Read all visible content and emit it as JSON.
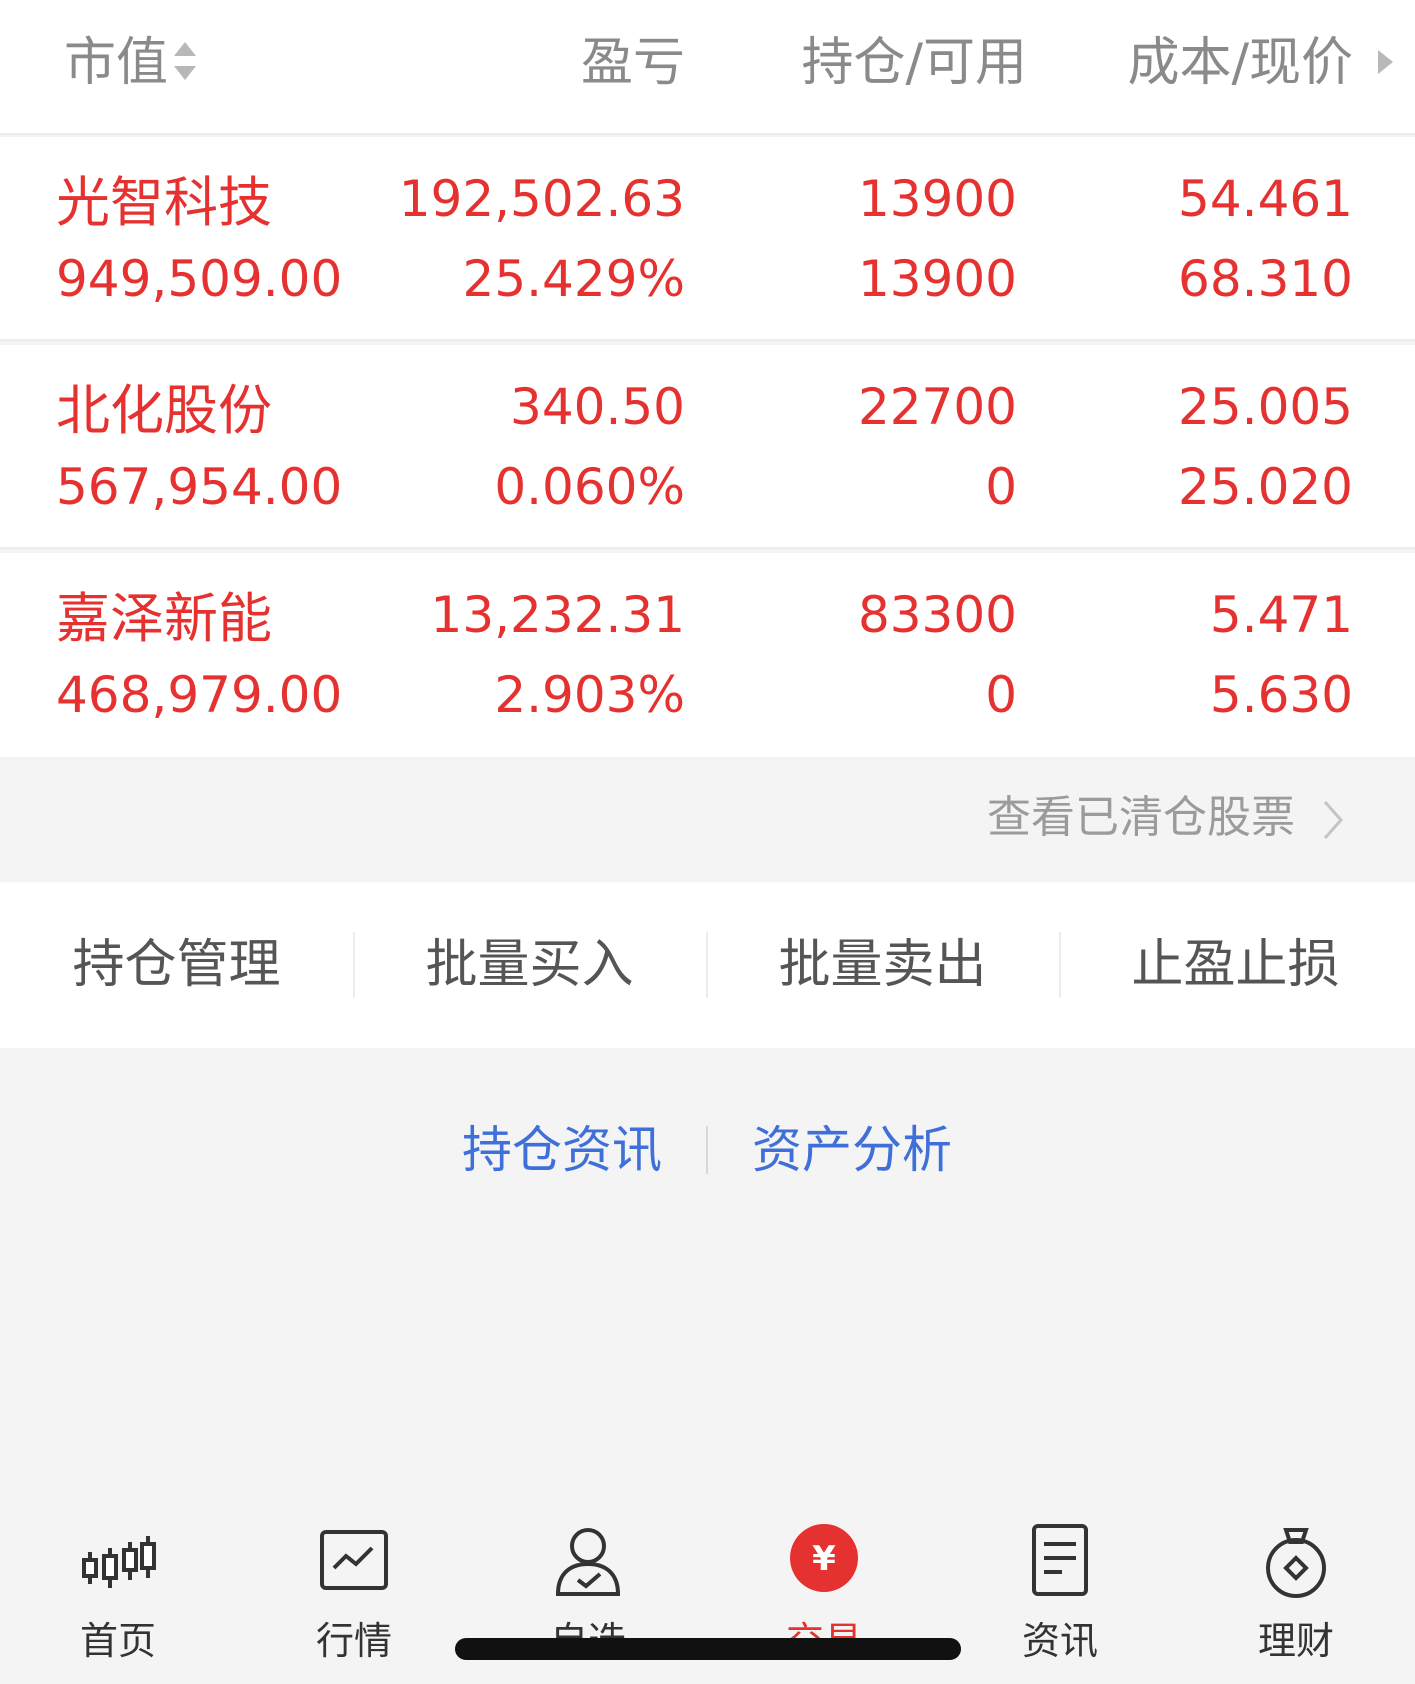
{
  "header": {
    "market_value": "市值",
    "profit_loss": "盈亏",
    "position_available": "持仓/可用",
    "cost_price": "成本/现价"
  },
  "holdings": [
    {
      "name": "光智科技",
      "market_value": "949,509.00",
      "profit_loss": "192,502.63",
      "profit_loss_pct": "25.429%",
      "position": "13900",
      "available": "13900",
      "cost": "54.461",
      "price": "68.310"
    },
    {
      "name": "北化股份",
      "market_value": "567,954.00",
      "profit_loss": "340.50",
      "profit_loss_pct": "0.060%",
      "position": "22700",
      "available": "0",
      "cost": "25.005",
      "price": "25.020"
    },
    {
      "name": "嘉泽新能",
      "market_value": "468,979.00",
      "profit_loss": "13,232.31",
      "profit_loss_pct": "2.903%",
      "position": "83300",
      "available": "0",
      "cost": "5.471",
      "price": "5.630"
    }
  ],
  "cleared_link": "查看已清仓股票",
  "actions": [
    "持仓管理",
    "批量买入",
    "批量卖出",
    "止盈止损"
  ],
  "links": [
    "持仓资讯",
    "资产分析"
  ],
  "tabs": [
    {
      "label": "首页",
      "icon": "candlestick-icon"
    },
    {
      "label": "行情",
      "icon": "chart-line-icon"
    },
    {
      "label": "自选",
      "icon": "user-check-icon"
    },
    {
      "label": "交易",
      "icon": "yuan-circle-icon",
      "active": true
    },
    {
      "label": "资讯",
      "icon": "document-icon"
    },
    {
      "label": "理财",
      "icon": "money-bag-icon"
    }
  ],
  "colors": {
    "up": "#e5312f",
    "link": "#3f6fd8",
    "muted": "#8a8a8a"
  }
}
